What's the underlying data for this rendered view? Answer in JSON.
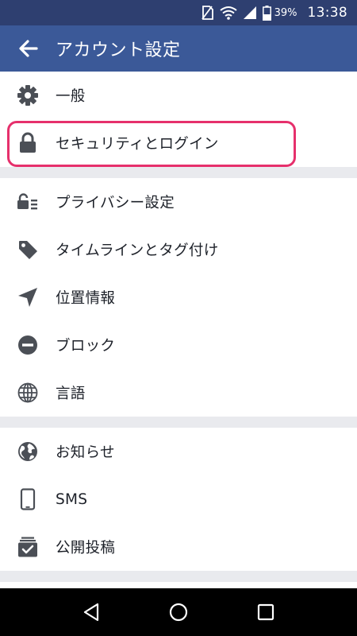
{
  "status_bar": {
    "battery_percent": "39%",
    "time": "13:38",
    "icons": [
      "no-sim-icon",
      "wifi-icon",
      "signal-icon",
      "battery-icon"
    ]
  },
  "app_bar": {
    "title": "アカウント設定",
    "back_icon": "arrow-left-icon"
  },
  "sections": [
    {
      "items": [
        {
          "label": "一般",
          "icon": "gear-icon"
        },
        {
          "label": "セキュリティとログイン",
          "icon": "lock-icon",
          "highlighted": true
        }
      ]
    },
    {
      "items": [
        {
          "label": "プライバシー設定",
          "icon": "lock-list-icon"
        },
        {
          "label": "タイムラインとタグ付け",
          "icon": "tag-icon"
        },
        {
          "label": "位置情報",
          "icon": "location-arrow-icon"
        },
        {
          "label": "ブロック",
          "icon": "block-icon"
        },
        {
          "label": "言語",
          "icon": "globe-grid-icon"
        }
      ]
    },
    {
      "items": [
        {
          "label": "お知らせ",
          "icon": "globe-icon"
        },
        {
          "label": "SMS",
          "icon": "phone-icon"
        },
        {
          "label": "公開投稿",
          "icon": "public-posts-icon"
        }
      ]
    }
  ],
  "colors": {
    "status_bar": "#2e3f70",
    "app_bar": "#3b5998",
    "icon": "#4b4f56",
    "text": "#1d2129",
    "divider": "#e9eaee",
    "highlight": "#e6306c",
    "nav_bar": "#000000"
  },
  "nav_bar": {
    "buttons": [
      "back-triangle-icon",
      "home-circle-icon",
      "recents-square-icon"
    ]
  }
}
